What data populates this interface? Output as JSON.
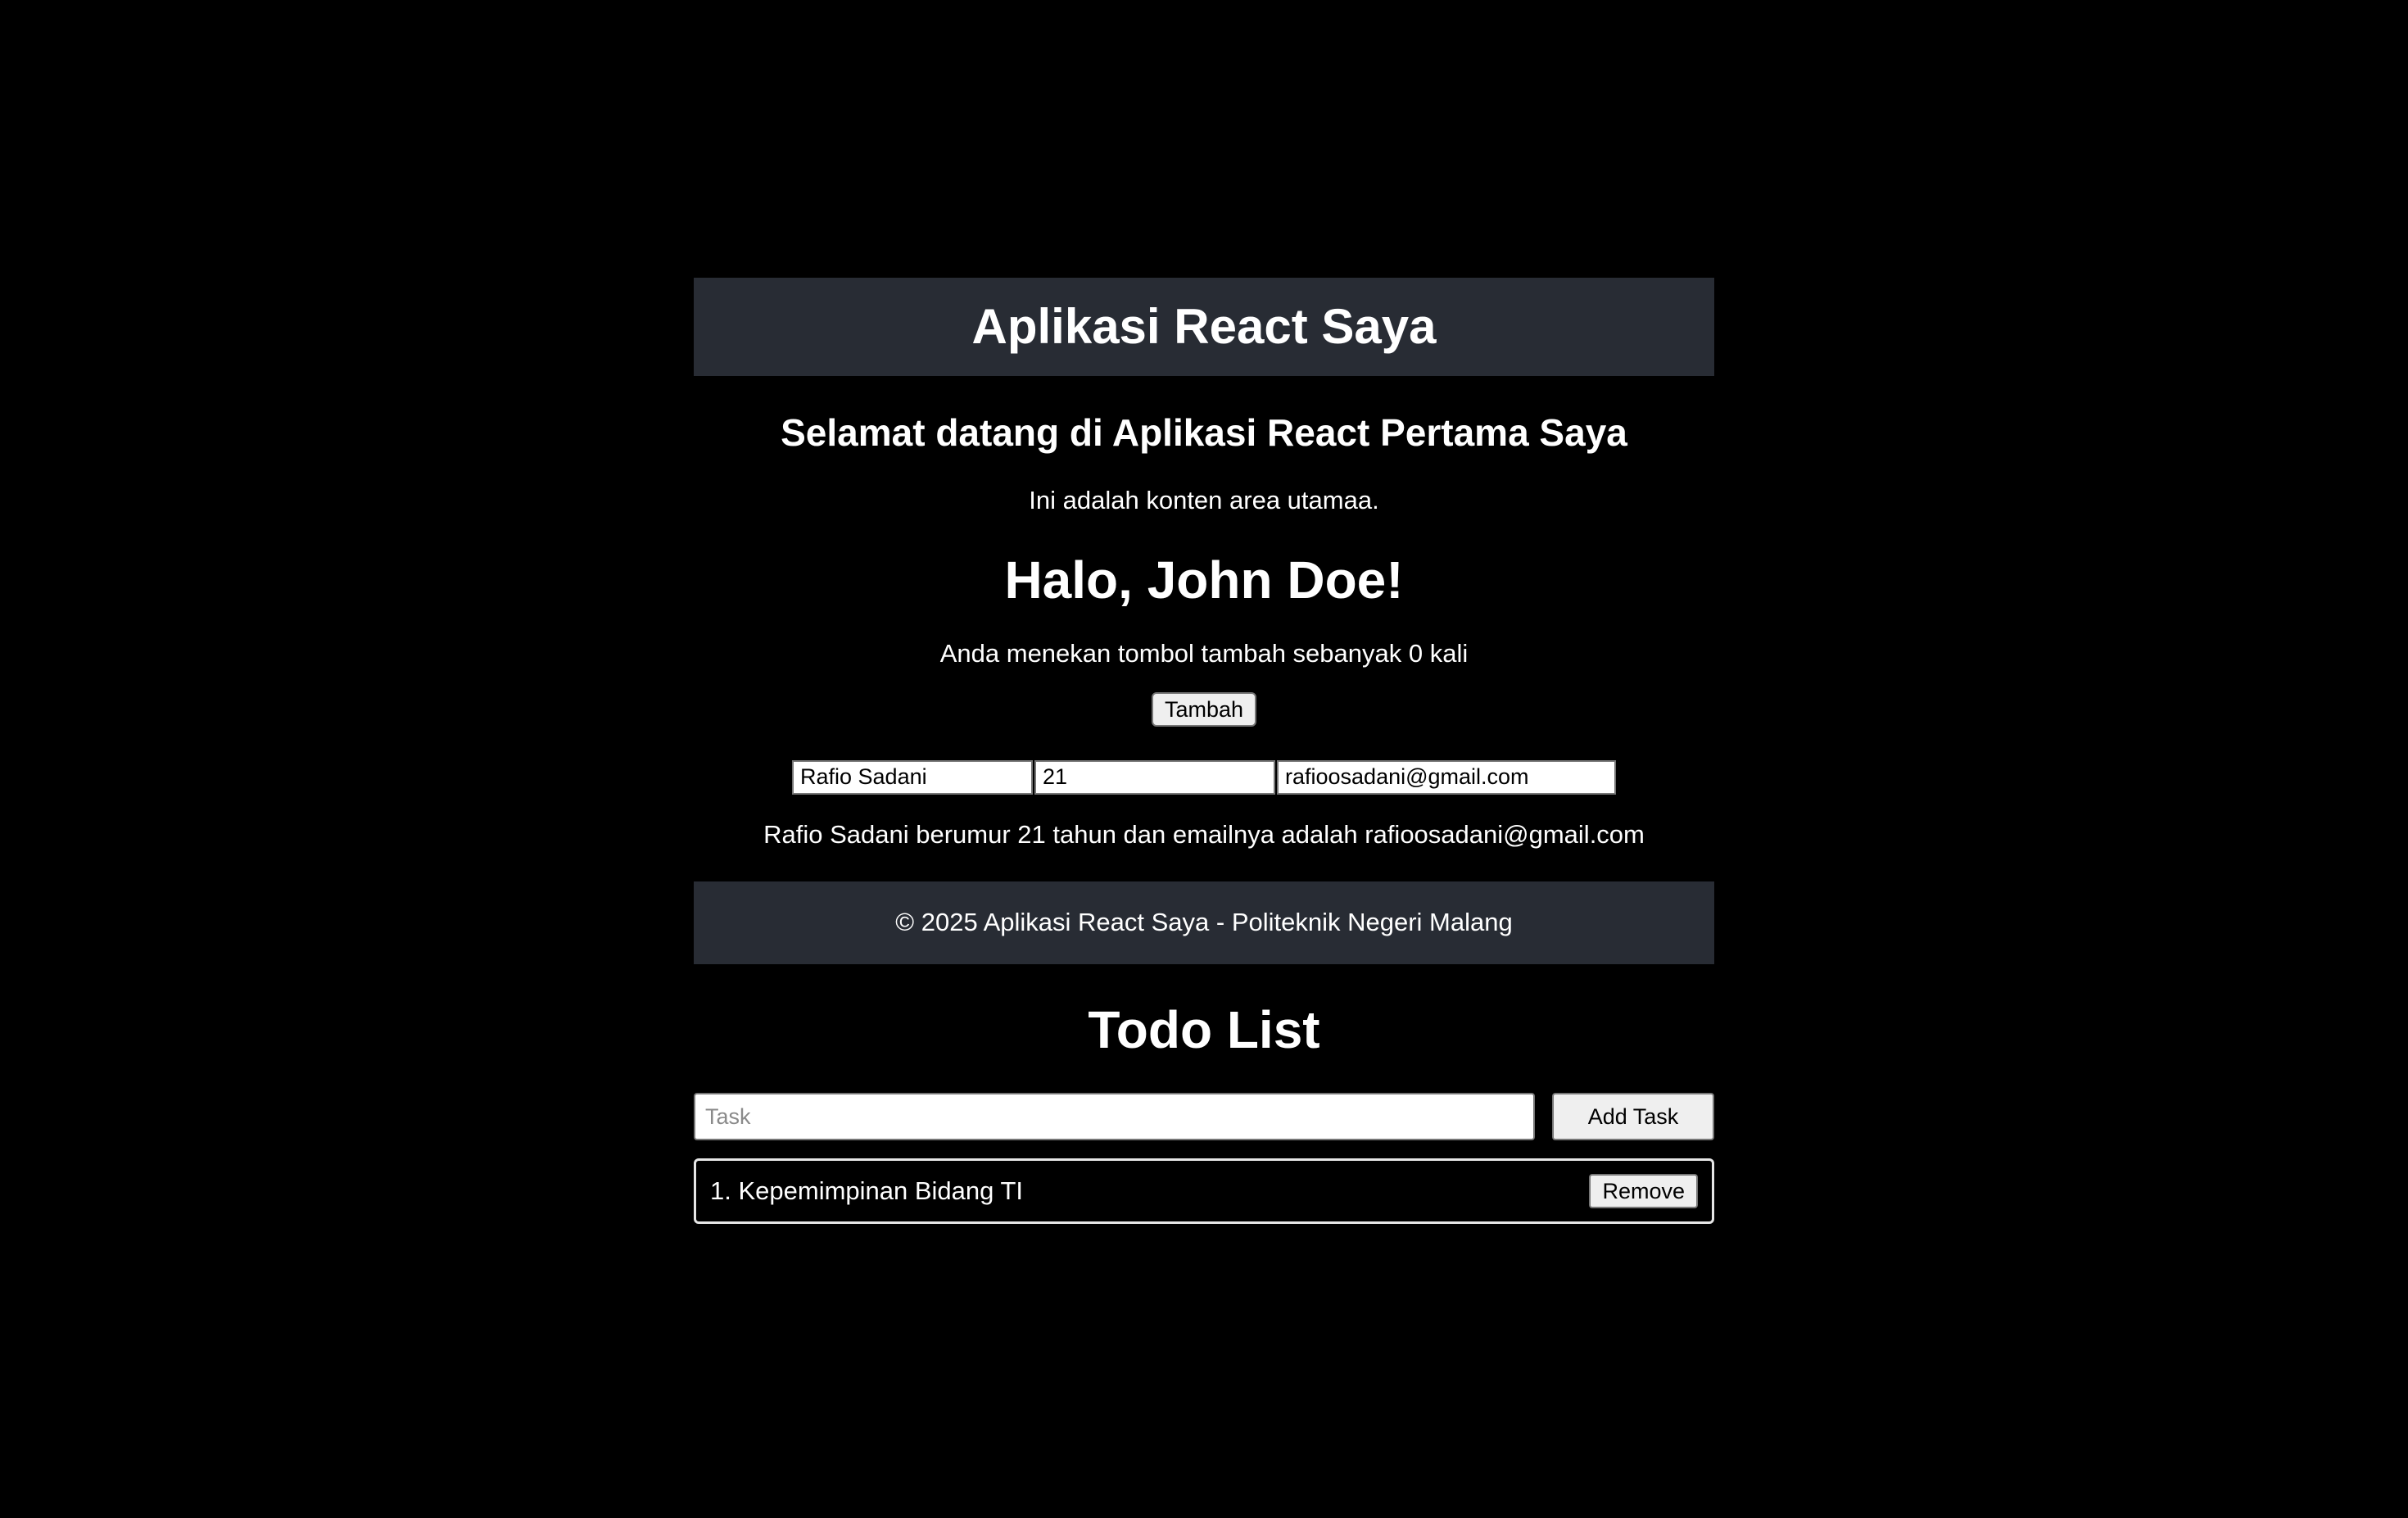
{
  "header": {
    "title": "Aplikasi React Saya"
  },
  "main": {
    "welcome": "Selamat datang di Aplikasi React Pertama Saya",
    "content_text": "Ini adalah konten area utamaa.",
    "greeting": "Halo, John Doe!",
    "counter_text": "Anda menekan tombol tambah sebanyak 0 kali",
    "add_button_label": "Tambah",
    "form": {
      "name_value": "Rafio Sadani",
      "age_value": "21",
      "email_value": "rafioosadani@gmail.com"
    },
    "summary": "Rafio Sadani berumur 21 tahun dan emailnya adalah rafioosadani@gmail.com"
  },
  "footer": {
    "text": "© 2025 Aplikasi React Saya - Politeknik Negeri Malang"
  },
  "todo": {
    "title": "Todo List",
    "input_placeholder": "Task",
    "add_task_label": "Add Task",
    "items": [
      {
        "text": "1. Kepemimpinan Bidang TI",
        "remove_label": "Remove"
      }
    ]
  },
  "colors": {
    "background": "#000000",
    "panel": "#282c34",
    "text": "#ffffff"
  }
}
